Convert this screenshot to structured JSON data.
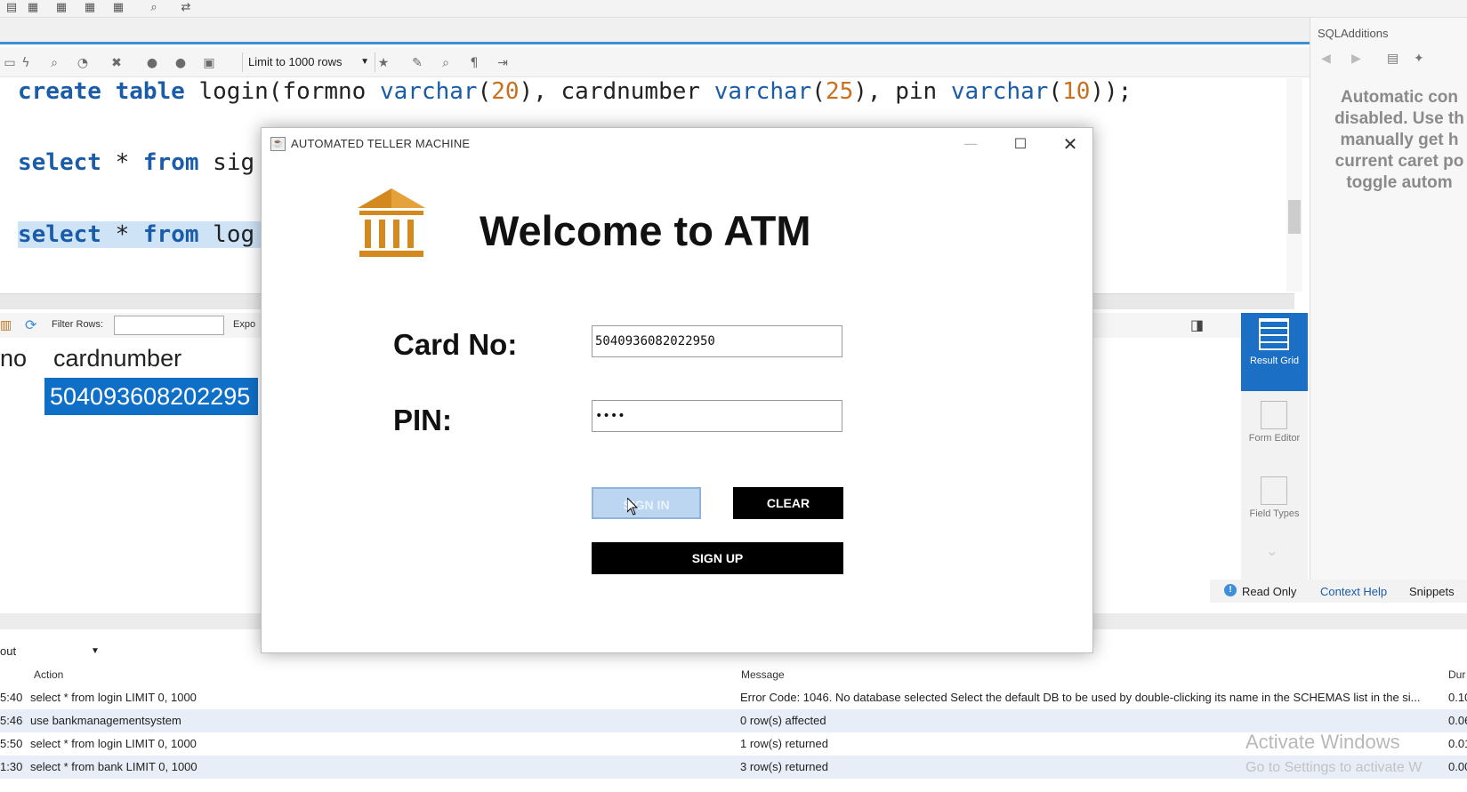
{
  "workbench": {
    "limit_select": "Limit to 1000 rows",
    "editor": {
      "line1": {
        "p1": "create table",
        "p2": " login(formno ",
        "p3": "varchar",
        "p4": "(",
        "p5": "20",
        "p6": "), cardnumber ",
        "p7": "varchar",
        "p8": "(",
        "p9": "25",
        "p10": "), pin ",
        "p11": "varchar",
        "p12": "(",
        "p13": "10",
        "p14": "));"
      },
      "line2": {
        "kw": "select",
        "rest": " * ",
        "kw2": "from",
        "rest2": " sig"
      },
      "line3": {
        "kw": "select",
        "rest": " * ",
        "kw2": "from",
        "rest2": " log"
      }
    },
    "result": {
      "filter_label": "Filter Rows:",
      "export_label": "Expo",
      "col_no": "no",
      "col_card": "cardnumber",
      "cell_card": "504093608202295"
    },
    "right_tabs": {
      "result_grid": "Result Grid",
      "form_editor": "Form Editor",
      "field_types": "Field Types"
    },
    "sql_additions": {
      "title": "SQLAdditions",
      "help_text": "Automatic con\ndisabled. Use th\nmanually get h\ncurrent caret po\ntoggle autom"
    },
    "status": {
      "read_only": "Read Only",
      "context_help": "Context Help",
      "snippets": "Snippets"
    },
    "output": {
      "select_value": "out",
      "headers": {
        "action": "Action",
        "message": "Message",
        "duration": "Dur"
      },
      "rows": [
        {
          "time": "5:40",
          "action": "select * from login LIMIT 0, 1000",
          "message": "Error Code: 1046. No database selected Select the default DB to be used by double-clicking its name in the SCHEMAS list in the si...",
          "duration": "0.10"
        },
        {
          "time": "5:46",
          "action": "use bankmanagementsystem",
          "message": "0 row(s) affected",
          "duration": "0.06"
        },
        {
          "time": "5:50",
          "action": "select * from login LIMIT 0, 1000",
          "message": "1 row(s) returned",
          "duration": "0.01"
        },
        {
          "time": "1:30",
          "action": "select * from bank LIMIT 0, 1000",
          "message": "3 row(s) returned",
          "duration": "0.00"
        }
      ]
    },
    "watermark": {
      "line1": "Activate Windows",
      "line2": "Go to Settings to activate W"
    }
  },
  "atm": {
    "window_title": "AUTOMATED TELLER MACHINE",
    "heading": "Welcome to ATM",
    "card_label": "Card No:",
    "card_value": "5040936082022950",
    "pin_label": "PIN:",
    "pin_value": "••••",
    "signin_label": "SIGN IN",
    "clear_label": "CLEAR",
    "signup_label": "SIGN UP",
    "logo_icon": "bank-icon",
    "colors": {
      "logo": "#d4891f",
      "button_dark": "#000000",
      "signin_hover": "#bcd6f2"
    }
  }
}
